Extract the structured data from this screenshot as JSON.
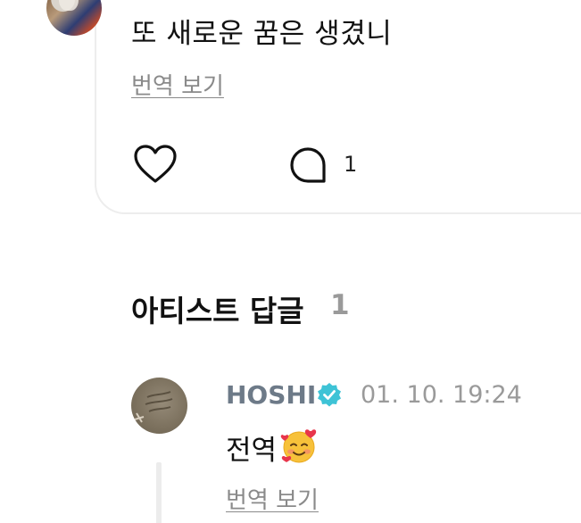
{
  "post": {
    "text": "또 새로운 꿈은 생겼니",
    "translate_label": "번역 보기",
    "like_icon": "heart-outline-icon",
    "comment_icon": "speech-bubble-icon",
    "comment_count": "1"
  },
  "artist_replies": {
    "title": "아티스트 답글",
    "count": "1",
    "reply": {
      "author": "HOSHI",
      "verified_icon": "verified-badge-icon",
      "verified_color": "#3ec3d6",
      "timestamp": "01. 10. 19:24",
      "text": "전역",
      "emoji": "smiling-face-with-hearts",
      "translate_label": "번역 보기"
    }
  }
}
